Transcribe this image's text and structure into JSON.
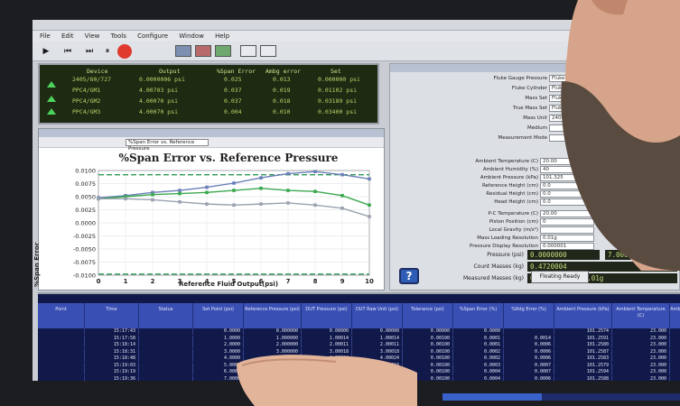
{
  "window": {
    "menu": [
      "File",
      "Edit",
      "View",
      "Tools",
      "Configure",
      "Window",
      "Help"
    ]
  },
  "toolbar": {
    "buttons": [
      {
        "name": "play-icon",
        "glyph": "▶"
      },
      {
        "name": "rewind-icon",
        "glyph": "⏮"
      },
      {
        "name": "fast-forward-icon",
        "glyph": "⏭"
      },
      {
        "name": "pause-icon",
        "glyph": "⏸"
      }
    ]
  },
  "readout": {
    "headers": [
      "Device",
      "Output",
      "%Span Error",
      "Ambg error",
      "Set"
    ],
    "rows": [
      [
        "2405/60/727",
        "0.0000006 psi",
        "0.025",
        "0.013",
        "0.000000 psi"
      ],
      [
        "PPC4/GM1",
        "4.00703 psi",
        "0.037",
        "0.019",
        "0.01102 psi"
      ],
      [
        "PPC4/GM2",
        "4.00070 psi",
        "0.037",
        "0.018",
        "0.03189 psi"
      ],
      [
        "PPC4/GM3",
        "4.00070 psi",
        "0.004",
        "0.010",
        "0.03400 psi"
      ]
    ]
  },
  "chart_window": {
    "dropdown": "%Span Error vs. Reference Pressure"
  },
  "chart_data": {
    "type": "line",
    "title": "%Span Error vs. Reference Pressure",
    "xlabel": "Reference Fluid Output(psi)",
    "ylabel": "%Span Error",
    "x": [
      0,
      1,
      2,
      3,
      4,
      5,
      6,
      7,
      8,
      9,
      10
    ],
    "ylim": [
      -0.01,
      0.01
    ],
    "yticks": [
      "0.0100",
      "0.0075",
      "0.0050",
      "0.0025",
      "0.0000",
      "-0.0025",
      "-0.0050",
      "-0.0075",
      "-0.0100"
    ],
    "series": [
      {
        "color": "#2f9a55",
        "dash": "6,3",
        "values": [
          0.0092,
          0.0092,
          0.0092,
          0.0092,
          0.0092,
          0.0092,
          0.0092,
          0.0092,
          0.0092,
          0.0092,
          0.0092
        ]
      },
      {
        "color": "#2f9a55",
        "dash": "6,3",
        "values": [
          -0.0098,
          -0.0098,
          -0.0098,
          -0.0098,
          -0.0098,
          -0.0098,
          -0.0098,
          -0.0098,
          -0.0098,
          -0.0098,
          -0.0098
        ]
      },
      {
        "color": "#6a7fb8",
        "dash": "",
        "values": [
          0.0048,
          0.0052,
          0.0058,
          0.0062,
          0.0068,
          0.0076,
          0.0086,
          0.0094,
          0.0098,
          0.0092,
          0.0084
        ]
      },
      {
        "color": "#3aa84f",
        "dash": "",
        "values": [
          0.0046,
          0.005,
          0.0054,
          0.0056,
          0.0058,
          0.0062,
          0.0066,
          0.0062,
          0.006,
          0.0052,
          0.0034
        ]
      },
      {
        "color": "#9aa2b0",
        "dash": "",
        "values": [
          0.0046,
          0.0046,
          0.0044,
          0.004,
          0.0036,
          0.0034,
          0.0036,
          0.0038,
          0.0034,
          0.0028,
          0.0012
        ]
      }
    ]
  },
  "right_panel": {
    "fields": [
      {
        "label": "Fluke Gauge Pressure",
        "value": "Fluke 2400"
      },
      {
        "label": "Fluke Cylinder",
        "value": "Fluke 2400/TS/UUT1"
      },
      {
        "label": "Mass Set",
        "value": "Fluke 2400/TS/XXXX"
      },
      {
        "label": "True Mass Set",
        "value": "Fluke"
      },
      {
        "label": "Mass Unit",
        "value": "2400-TS"
      },
      {
        "label": "Medium",
        "value": ""
      },
      {
        "label": "Measurement Mode",
        "value": ""
      }
    ],
    "conditions": [
      {
        "label": "Ambient Temperature (C)",
        "value": "20.00"
      },
      {
        "label": "Ambient Humidity (%)",
        "value": "40"
      },
      {
        "label": "Ambient Pressure (kPa)",
        "value": "101.325"
      },
      {
        "label": "Reference Height (cm)",
        "value": "0.0"
      },
      {
        "label": "Residual Height (cm)",
        "value": "0.0"
      },
      {
        "label": "Head Height (cm)",
        "value": "0.0"
      }
    ],
    "piston": [
      {
        "label": "P-C Temperature (C)",
        "value": "20.00"
      },
      {
        "label": "Piston Position (cm)",
        "value": "0"
      },
      {
        "label": "Local Gravity (m/s²)",
        "value": ""
      },
      {
        "label": "Mass Loading Resolution",
        "value": "0.01g"
      },
      {
        "label": "Pressure Display Resolution",
        "value": "0.000001"
      }
    ],
    "pressure_label": "Pressure (psi)",
    "pressure_value": "0.0000000",
    "pressure_target": "7.00000",
    "count_label": "Count Masses (kg)",
    "count_value": "0.4720004",
    "mass_label": "Measured Masses (kg)",
    "mass_value": "0.4500000 kg  8.01g",
    "help_label": "?",
    "ready_button": "Floating Ready"
  },
  "table": {
    "headers": [
      "Point",
      "Time",
      "Status",
      "Set Point (psi)",
      "Reference Pressure (psi)",
      "DUT Pressure (psi)",
      "DUT Raw Unit (psi)",
      "Tolerance (psi)",
      "%Span Error (%)",
      "%Rdg Error (%)",
      "Ambient Pressure (kPa)",
      "Ambient Temperature (C)",
      "Ambient Humidity (%RH)"
    ],
    "rows": [
      [
        "",
        "15:17:43",
        "",
        "0.0000",
        "0.000000",
        "0.00000",
        "0.00000",
        "0.00000",
        "0.0000",
        "",
        "101.2574",
        "23.000",
        "47"
      ],
      [
        "",
        "15:17:58",
        "",
        "1.0000",
        "1.000000",
        "1.00014",
        "1.00014",
        "0.00100",
        "0.0001",
        "0.0014",
        "101.2591",
        "23.000",
        "47"
      ],
      [
        "",
        "15:18:14",
        "",
        "2.0000",
        "2.000000",
        "2.00011",
        "2.00011",
        "0.00100",
        "0.0001",
        "0.0006",
        "101.2580",
        "23.000",
        "47"
      ],
      [
        "",
        "15:18:31",
        "",
        "3.0000",
        "3.000000",
        "3.00018",
        "3.00018",
        "0.00100",
        "0.0002",
        "0.0006",
        "101.2587",
        "23.000",
        "47"
      ],
      [
        "",
        "15:18:48",
        "",
        "4.0000",
        "4.000000",
        "4.00024",
        "4.00024",
        "0.00100",
        "0.0002",
        "0.0006",
        "101.2583",
        "23.000",
        "47"
      ],
      [
        "",
        "15:19:03",
        "",
        "5.0000",
        "5.000000",
        "5.00034",
        "5.00034",
        "0.00100",
        "0.0003",
        "0.0007",
        "101.2579",
        "23.000",
        "47"
      ],
      [
        "",
        "15:19:19",
        "",
        "6.0000",
        "6.000000",
        "6.00042",
        "6.00042",
        "0.00100",
        "0.0004",
        "0.0007",
        "101.2594",
        "23.000",
        "47"
      ],
      [
        "",
        "15:19:36",
        "",
        "7.0000",
        "7.000000",
        "7.00039",
        "7.00039",
        "0.00100",
        "0.0004",
        "0.0006",
        "101.2588",
        "23.000",
        "47"
      ]
    ]
  },
  "progress": {
    "fraction": 0.42
  }
}
